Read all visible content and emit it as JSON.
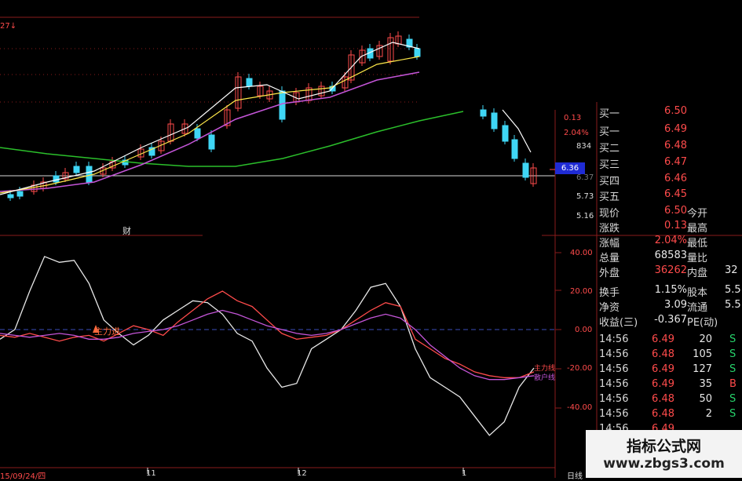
{
  "colors": {
    "up": "#ff4b4b",
    "down": "#3fd6f5",
    "ma5": "#ffffff",
    "ma10": "#ffe94a",
    "ma20": "#c455d8",
    "ma60": "#2bbf2b",
    "grid": "#8a1b1b",
    "accent": "#1f2bd4"
  },
  "chart_top_left": "27↓",
  "header_label": "财",
  "price_axis": [
    "0.13",
    "2.04%",
    "834",
    "6.36",
    "6.37",
    "5.73",
    "5.16"
  ],
  "indicator_axis": [
    "40.00",
    "20.00",
    "0.00",
    "-20.00",
    "-40.00"
  ],
  "signal_text": "主力进",
  "legend_right": "主力线",
  "legend_right2": "散户线",
  "date_axis": [
    "15/09/24/四",
    "11",
    "12",
    "1",
    "日线"
  ],
  "quote": {
    "book": [
      {
        "label": "买一",
        "value": "6.50",
        "cut": true
      },
      {
        "label": "买一",
        "value": "6.49"
      },
      {
        "label": "买二",
        "value": "6.48"
      },
      {
        "label": "买三",
        "value": "6.47"
      },
      {
        "label": "买四",
        "value": "6.46"
      },
      {
        "label": "买五",
        "value": "6.45"
      }
    ],
    "stats": [
      {
        "l1": "现价",
        "v1": "6.50",
        "c1": "red",
        "l2": "今开",
        "v2": ""
      },
      {
        "l1": "涨跌",
        "v1": "0.13",
        "c1": "red",
        "l2": "最高",
        "v2": ""
      },
      {
        "l1": "涨幅",
        "v1": "2.04%",
        "c1": "red",
        "l2": "最低",
        "v2": ""
      },
      {
        "l1": "总量",
        "v1": "68583",
        "c1": "wht",
        "l2": "量比",
        "v2": ""
      },
      {
        "l1": "外盘",
        "v1": "36262",
        "c1": "red",
        "l2": "内盘",
        "v2": "32"
      },
      {
        "l1": "换手",
        "v1": "1.15%",
        "c1": "wht",
        "l2": "股本",
        "v2": "5.5"
      },
      {
        "l1": "净资",
        "v1": "3.09",
        "c1": "wht",
        "l2": "流通",
        "v2": "5.5"
      },
      {
        "l1": "收益(三)",
        "v1": "-0.367",
        "c1": "wht",
        "l2": "PE(动)",
        "v2": ""
      }
    ],
    "ticks": [
      {
        "time": "14:56",
        "price": "6.49",
        "vol": "20",
        "side": "S"
      },
      {
        "time": "14:56",
        "price": "6.48",
        "vol": "105",
        "side": "S"
      },
      {
        "time": "14:56",
        "price": "6.49",
        "vol": "127",
        "side": "S"
      },
      {
        "time": "14:56",
        "price": "6.49",
        "vol": "35",
        "side": "B"
      },
      {
        "time": "14:56",
        "price": "6.48",
        "vol": "50",
        "side": "S"
      },
      {
        "time": "14:56",
        "price": "6.48",
        "vol": "2",
        "side": "S"
      },
      {
        "time": "14:56",
        "price": "6.49",
        "vol": "",
        "side": ""
      }
    ]
  },
  "watermark": {
    "title": "指标公式网",
    "url": "www.zbgs3.com"
  },
  "chart_data": {
    "type": "line",
    "series": [
      {
        "values": [
          -5,
          0,
          20,
          38,
          35,
          36,
          24,
          5,
          -2,
          -8,
          -3,
          5,
          10,
          15,
          14,
          8,
          -2,
          -6,
          -20,
          -30,
          -28,
          -10,
          -5,
          0,
          10,
          22,
          24,
          12,
          -10,
          -25,
          -30,
          -35,
          -45,
          -55,
          -48,
          -30,
          -20
        ]
      },
      {
        "values": [
          -3,
          -4,
          -2,
          -4,
          -6,
          -4,
          -3,
          -6,
          -2,
          2,
          0,
          -3,
          4,
          10,
          16,
          20,
          15,
          12,
          5,
          -2,
          -5,
          -4,
          -3,
          0,
          5,
          10,
          14,
          12,
          -5,
          -10,
          -15,
          -18,
          -22,
          -24,
          -25,
          -25,
          -22
        ]
      },
      {
        "values": [
          -2,
          -3,
          -4,
          -3,
          -2,
          -3,
          -5,
          -5,
          -4,
          -2,
          -1,
          0,
          2,
          5,
          8,
          10,
          8,
          5,
          2,
          0,
          -2,
          -3,
          -2,
          0,
          3,
          6,
          8,
          6,
          0,
          -8,
          -14,
          -20,
          -24,
          -26,
          -26,
          -25,
          -24
        ]
      }
    ]
  }
}
